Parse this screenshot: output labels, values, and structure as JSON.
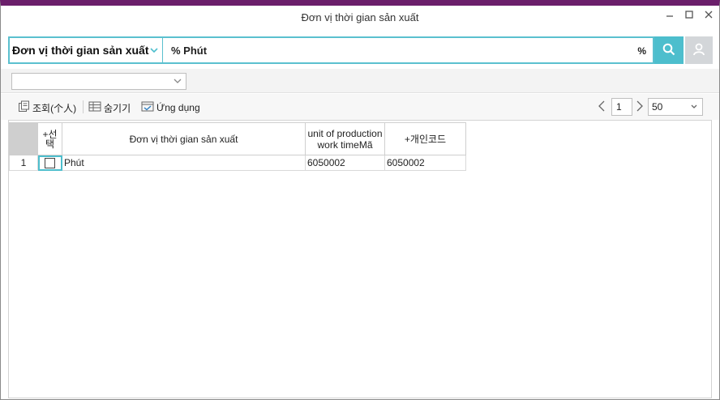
{
  "window": {
    "title": "Đơn vị thời gian sản xuất"
  },
  "search": {
    "field_label": "Đơn vị thời gian sản xuất",
    "value": "% Phút",
    "suffix": "%"
  },
  "filter": {
    "selected": ""
  },
  "toolbar": {
    "query_label": "조회(个人)",
    "hide_label": "숨기기",
    "apply_label": "Ứng dụng"
  },
  "pager": {
    "page": "1",
    "page_size": "50"
  },
  "grid": {
    "columns": [
      "+선택",
      "Đơn vị thời gian sản xuất",
      "unit of production work timeMã",
      "+개인코드"
    ],
    "rows": [
      {
        "num": "1",
        "name": "Phút",
        "code": "6050002",
        "personal_code": "6050002"
      }
    ]
  },
  "colors": {
    "accent": "#4dbecd",
    "title_border": "#6b1f6b"
  },
  "icons": [
    "minimize-icon",
    "maximize-icon",
    "close-icon",
    "chevron-down-icon",
    "search-icon",
    "reset-user-icon",
    "query-icon",
    "hide-icon",
    "apply-icon",
    "chevron-left-icon",
    "chevron-right-icon"
  ]
}
